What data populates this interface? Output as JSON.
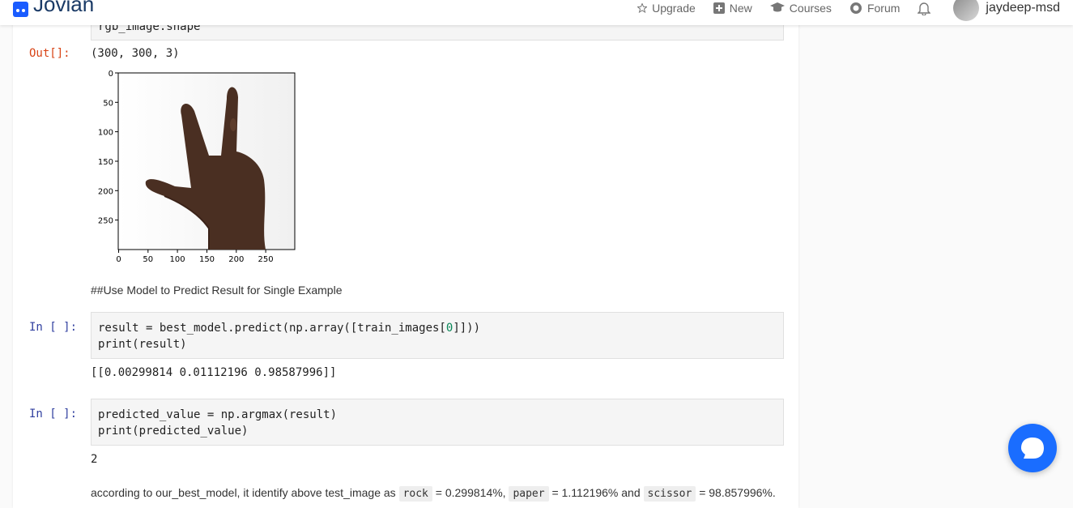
{
  "header": {
    "logo_text": "Jovian",
    "nav": {
      "upgrade": "Upgrade",
      "new": "New",
      "courses": "Courses",
      "forum": "Forum"
    },
    "username": "jaydeep-msd"
  },
  "cells": {
    "shape_cell_code": "rgb_image.shape",
    "shape_out_prompt": "Out[]:",
    "shape_out_value": "(300, 300, 3)",
    "plot": {
      "y_ticks": [
        "0",
        "50",
        "100",
        "150",
        "200",
        "250"
      ],
      "x_ticks": [
        "0",
        "50",
        "100",
        "150",
        "200",
        "250"
      ]
    },
    "markdown_heading": "##Use Model to Predict Result for Single Example",
    "predict_cell": {
      "prompt": "In [ ]:",
      "line1_a": "result = best_model.predict(np.array([train_images[",
      "line1_num": "0",
      "line1_b": "]]))",
      "line2": "print(result)",
      "output": "[[0.00299814 0.01112196 0.98587996]]"
    },
    "argmax_cell": {
      "prompt": "In [ ]:",
      "line1": "predicted_value = np.argmax(result)",
      "line2": "print(predicted_value)",
      "output": "2"
    },
    "conclusion": {
      "part1": "according to our_best_model, it identify above test_image as",
      "code1": "rock",
      "part2": "= 0.299814%,",
      "code2": "paper",
      "part3": "= 1.112196% and",
      "code3": "scissor",
      "part4": "= 98.857996%."
    }
  },
  "colors": {
    "brand": "#1a5cff",
    "out_prompt": "#d84315",
    "in_prompt": "#303f9f",
    "chat": "#1a6dff"
  }
}
